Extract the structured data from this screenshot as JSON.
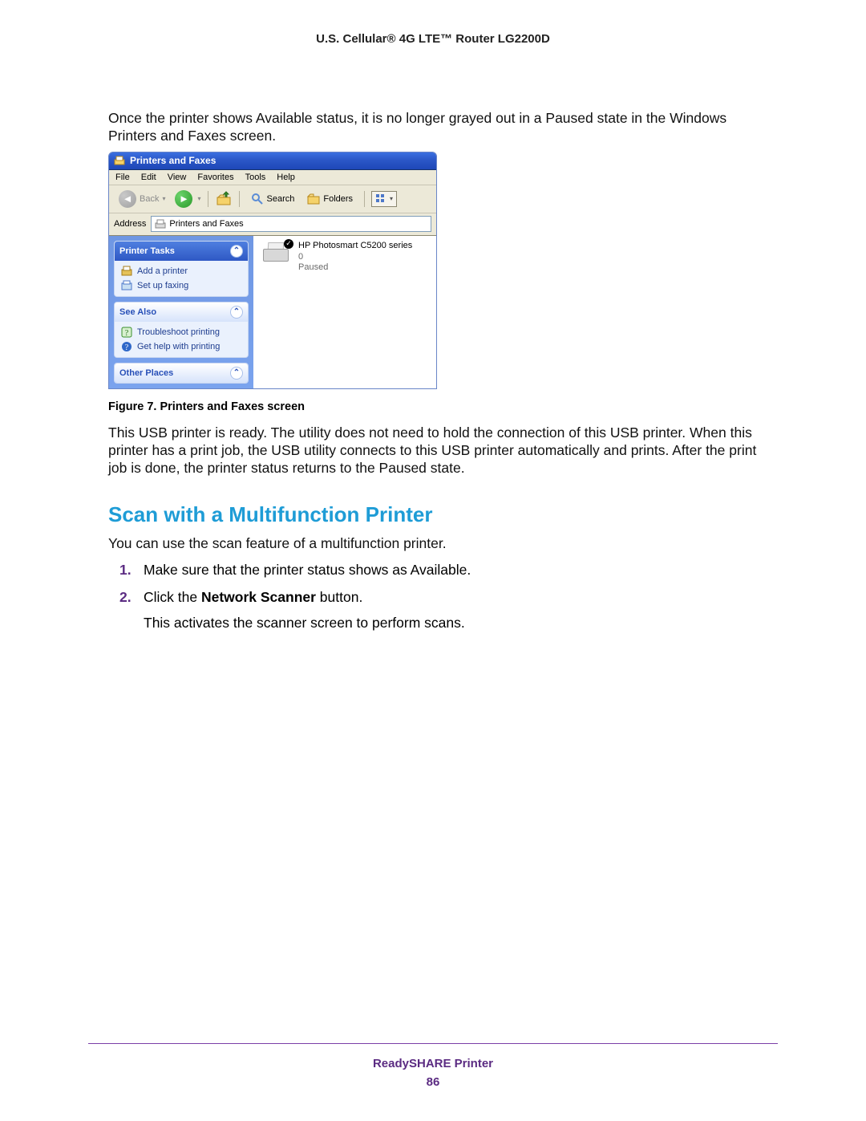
{
  "doc_header": "U.S. Cellular® 4G LTE™ Router LG2200D",
  "para1": "Once the printer shows Available status, it is no longer grayed out in a Paused state in the Windows Printers and Faxes screen.",
  "figure_caption": "Figure 7. Printers and Faxes screen",
  "para2": "This USB printer is ready. The utility does not need to hold the connection of this USB printer. When this printer has a print job, the USB utility connects to this USB printer automatically and prints. After the print job is done, the printer status returns to the Paused state.",
  "section_heading": "Scan with a Multifunction Printer",
  "section_intro": "You can use the scan feature of a multifunction printer.",
  "steps": {
    "s1": "Make sure that the printer status shows as Available.",
    "s2_pre": "Click the ",
    "s2_strong": "Network Scanner",
    "s2_post": " button.",
    "s2_sub": "This activates the scanner screen to perform scans."
  },
  "footer": {
    "title": "ReadySHARE Printer",
    "page": "86"
  },
  "xp": {
    "title": "Printers and Faxes",
    "menu": {
      "file": "File",
      "edit": "Edit",
      "view": "View",
      "favorites": "Favorites",
      "tools": "Tools",
      "help": "Help"
    },
    "toolbar": {
      "back": "Back",
      "search": "Search",
      "folders": "Folders"
    },
    "address_label": "Address",
    "address_value": "Printers and Faxes",
    "panel_tasks": {
      "title": "Printer Tasks",
      "add_printer": "Add a printer",
      "setup_faxing": "Set up faxing"
    },
    "panel_seealso": {
      "title": "See Also",
      "troubleshoot": "Troubleshoot printing",
      "get_help": "Get help with printing"
    },
    "panel_other": {
      "title": "Other Places"
    },
    "item": {
      "name": "HP Photosmart C5200 series",
      "docs": "0",
      "status": "Paused"
    }
  }
}
